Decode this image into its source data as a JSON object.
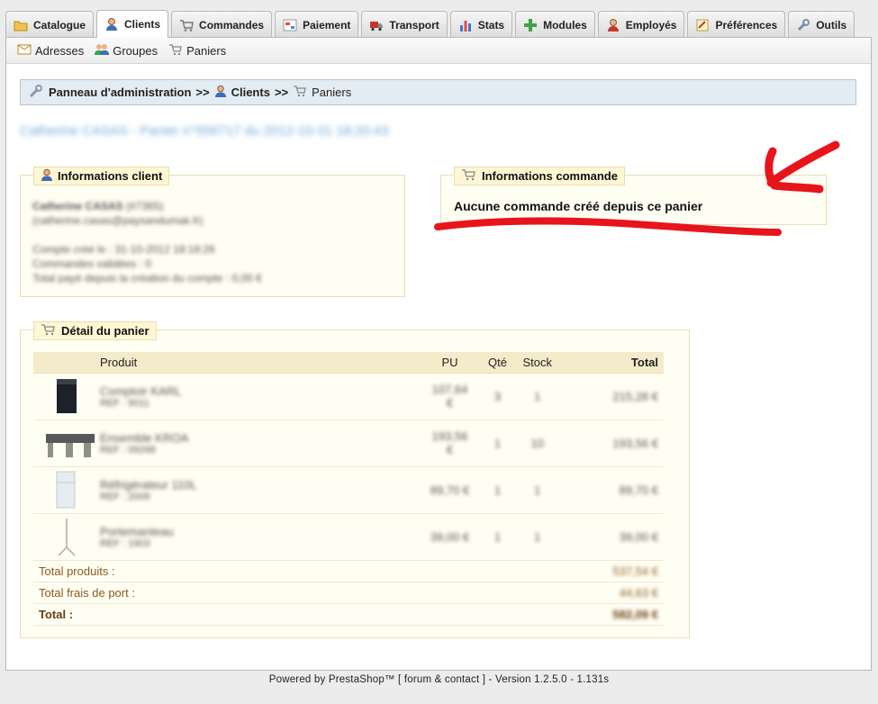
{
  "tabs": [
    {
      "label": "Catalogue",
      "icon": "folder-icon",
      "active": false
    },
    {
      "label": "Clients",
      "icon": "user-icon",
      "active": true
    },
    {
      "label": "Commandes",
      "icon": "cart-icon",
      "active": false
    },
    {
      "label": "Paiement",
      "icon": "payment-icon",
      "active": false
    },
    {
      "label": "Transport",
      "icon": "truck-icon",
      "active": false
    },
    {
      "label": "Stats",
      "icon": "chart-icon",
      "active": false
    },
    {
      "label": "Modules",
      "icon": "puzzle-icon",
      "active": false
    },
    {
      "label": "Employés",
      "icon": "employee-icon",
      "active": false
    },
    {
      "label": "Préférences",
      "icon": "preferences-icon",
      "active": false
    },
    {
      "label": "Outils",
      "icon": "wrench-icon",
      "active": false
    }
  ],
  "subnav": {
    "adresses": "Adresses",
    "groupes": "Groupes",
    "paniers": "Paniers"
  },
  "breadcrumb": {
    "admin": "Panneau d'administration",
    "sep1": ">>",
    "clients": "Clients",
    "sep2": ">>",
    "paniers": "Paniers"
  },
  "page_title": "Catherine CASAS - Panier n°556717 du 2012-10-31 18:20:43",
  "client_info": {
    "legend": "Informations client",
    "name": "Catherine CASAS",
    "id": "(#7365)",
    "email": "(catherine.casas@paysandumak.fr)",
    "account_created": "Compte créé le : 31-10-2012 18:18:26",
    "valid_orders": "Commandes validées : 0",
    "total_paid": "Total payé depuis la création du compte : 0,00 €"
  },
  "order_info": {
    "legend": "Informations commande",
    "message": "Aucune commande créé depuis ce panier"
  },
  "cart": {
    "legend": "Détail du panier",
    "headers": {
      "produit": "Produit",
      "pu": "PU",
      "qte": "Qté",
      "stock": "Stock",
      "total": "Total"
    },
    "rows": [
      {
        "name": "Comptoir KARL",
        "ref": "REF : 9011",
        "pu": "107,64 €",
        "qte": "3",
        "stock": "1",
        "total": "215,28 €"
      },
      {
        "name": "Ensemble KROA",
        "ref": "REF : 09298",
        "pu": "193,56 €",
        "qte": "1",
        "stock": "10",
        "total": "193,56 €"
      },
      {
        "name": "Réfrigérateur 110L",
        "ref": "REF : 2009",
        "pu": "89,70 €",
        "qte": "1",
        "stock": "1",
        "total": "89,70 €"
      },
      {
        "name": "Portemanteau",
        "ref": "REF : 1903",
        "pu": "39,00 €",
        "qte": "1",
        "stock": "1",
        "total": "39,00 €"
      }
    ],
    "total_produits_label": "Total produits :",
    "total_produits": "537,54 €",
    "frais_port_label": "Total frais de port :",
    "frais_port": "44,63 €",
    "total_label": "Total :",
    "total": "582,09 €"
  },
  "footer": "Powered by PrestaShop™ [ forum & contact ] - Version 1.2.5.0 - 1.131s",
  "colors": {
    "annotation": "#e8141c",
    "breadcrumb_bg": "#e3ecf2",
    "fieldset_bg": "#fffef3",
    "legend_bg": "#fff6d3"
  }
}
